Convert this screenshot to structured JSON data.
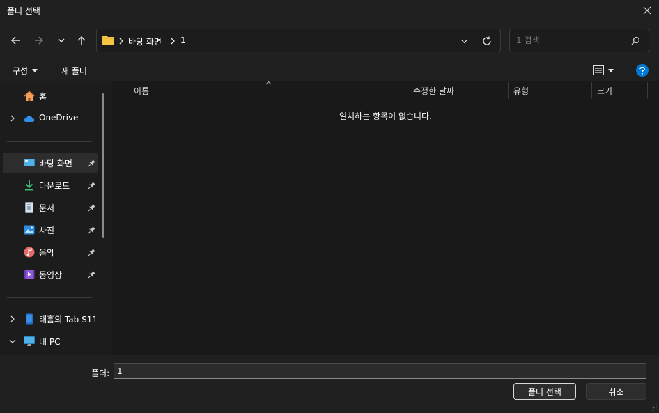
{
  "window": {
    "title": "폴더 선택"
  },
  "address": {
    "crumbs": [
      "바탕 화면",
      "1"
    ]
  },
  "search": {
    "placeholder": "1 검색"
  },
  "commands": {
    "organize": "구성",
    "new_folder": "새 폴더"
  },
  "sidebar": {
    "groups": [
      {
        "items": [
          {
            "label": "홈",
            "icon": "home-icon",
            "expandable": false
          },
          {
            "label": "OneDrive",
            "icon": "cloud-icon",
            "expandable": true
          }
        ]
      },
      {
        "items": [
          {
            "label": "바탕 화면",
            "icon": "desktop-icon",
            "pinned": true,
            "selected": true
          },
          {
            "label": "다운로드",
            "icon": "download-icon",
            "pinned": true
          },
          {
            "label": "문서",
            "icon": "document-icon",
            "pinned": true
          },
          {
            "label": "사진",
            "icon": "pictures-icon",
            "pinned": true
          },
          {
            "label": "음악",
            "icon": "music-icon",
            "pinned": true
          },
          {
            "label": "동영상",
            "icon": "video-icon",
            "pinned": true
          }
        ]
      },
      {
        "items": [
          {
            "label": "태흠의 Tab S11",
            "icon": "tablet-icon",
            "expandable": true
          },
          {
            "label": "내 PC",
            "icon": "pc-icon",
            "expandable": true,
            "expanded": true
          }
        ]
      }
    ]
  },
  "columns": [
    "이름",
    "수정한 날짜",
    "유형",
    "크기"
  ],
  "empty_message": "일치하는 항목이 없습니다.",
  "footer": {
    "folder_label": "폴더:",
    "folder_value": "1",
    "select_label": "폴더 선택",
    "cancel_label": "취소"
  },
  "colors": {
    "accent": "#0078d4",
    "folder": "#f6c643"
  }
}
